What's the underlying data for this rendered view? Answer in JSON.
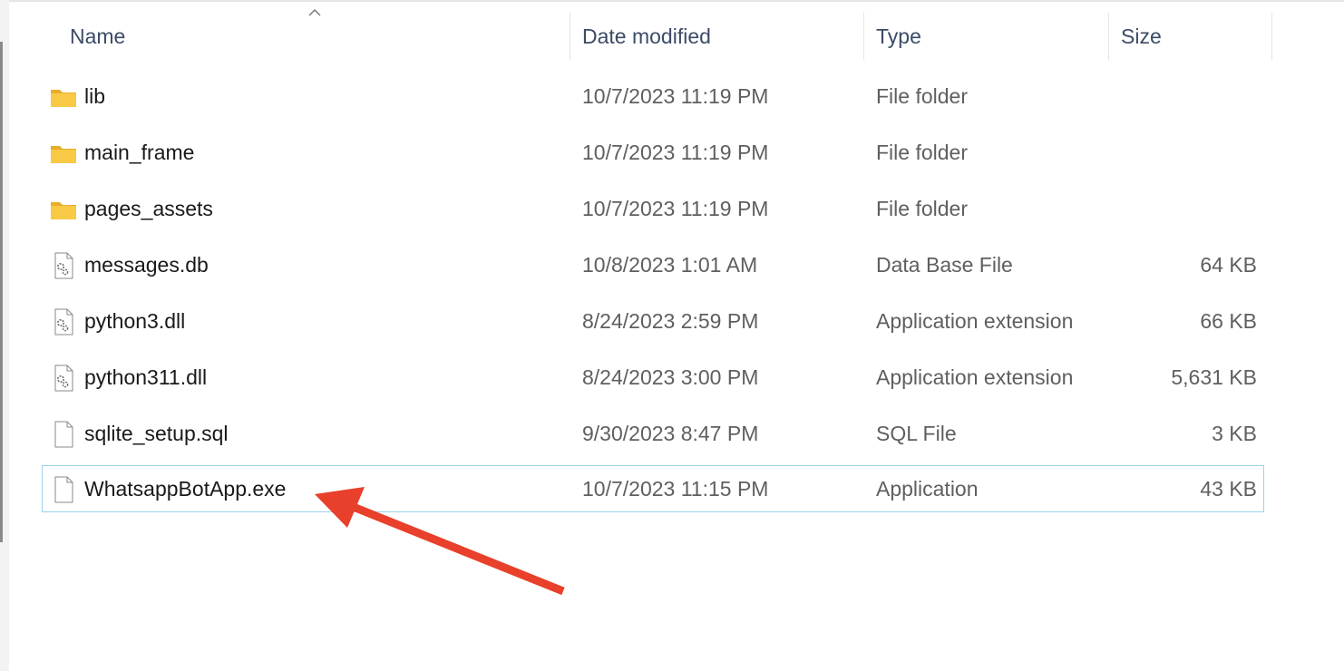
{
  "columns": {
    "name": "Name",
    "date": "Date modified",
    "type": "Type",
    "size": "Size"
  },
  "sort": {
    "column": "name",
    "direction": "ascending",
    "icon": "chevron-up-icon"
  },
  "rows": [
    {
      "name": "lib",
      "date": "10/7/2023 11:19 PM",
      "type": "File folder",
      "size": "",
      "icon": "folder-icon"
    },
    {
      "name": "main_frame",
      "date": "10/7/2023 11:19 PM",
      "type": "File folder",
      "size": "",
      "icon": "folder-icon"
    },
    {
      "name": "pages_assets",
      "date": "10/7/2023 11:19 PM",
      "type": "File folder",
      "size": "",
      "icon": "folder-icon"
    },
    {
      "name": "messages.db",
      "date": "10/8/2023 1:01 AM",
      "type": "Data Base File",
      "size": "64 KB",
      "icon": "settings-file-icon"
    },
    {
      "name": "python3.dll",
      "date": "8/24/2023 2:59 PM",
      "type": "Application extension",
      "size": "66 KB",
      "icon": "settings-file-icon"
    },
    {
      "name": "python311.dll",
      "date": "8/24/2023 3:00 PM",
      "type": "Application extension",
      "size": "5,631 KB",
      "icon": "settings-file-icon"
    },
    {
      "name": "sqlite_setup.sql",
      "date": "9/30/2023 8:47 PM",
      "type": "SQL File",
      "size": "3 KB",
      "icon": "blank-file-icon"
    },
    {
      "name": "WhatsappBotApp.exe",
      "date": "10/7/2023 11:15 PM",
      "type": "Application",
      "size": "43 KB",
      "icon": "blank-file-icon"
    }
  ],
  "selected_row": "WhatsappBotApp.exe",
  "colors": {
    "header_text": "#3c4b66",
    "name_text": "#1a1a1a",
    "detail_text": "#5f5f5f",
    "selection_border": "#9bd2e9",
    "folder_yellow": "#f8c945",
    "annotation_arrow": "#e8402a"
  }
}
